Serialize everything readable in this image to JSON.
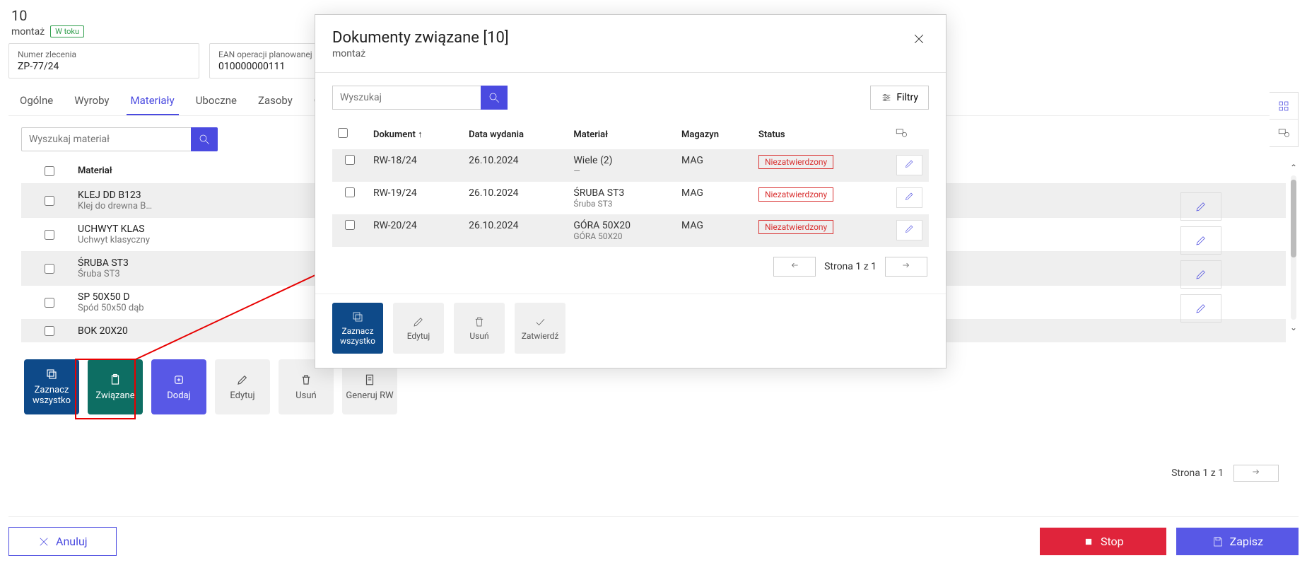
{
  "header": {
    "number": "10",
    "name": "montaż",
    "status": "W toku"
  },
  "info": {
    "order_no_label": "Numer zlecenia",
    "order_no": "ZP-77/24",
    "ean_label": "EAN operacji planowanej",
    "ean": "010000000111"
  },
  "tabs": [
    "Ogólne",
    "Wyroby",
    "Materiały",
    "Uboczne",
    "Zasoby",
    "Op"
  ],
  "active_tab_index": 2,
  "material_search_placeholder": "Wyszukaj materiał",
  "material_header": "Materiał",
  "materials": [
    {
      "code": "KLEJ DD B123",
      "desc": "Klej do drewna B…"
    },
    {
      "code": "UCHWYT KLAS",
      "desc": "Uchwyt klasyczny"
    },
    {
      "code": "ŚRUBA ST3",
      "desc": "Śruba ST3"
    },
    {
      "code": "SP 50X50 D",
      "desc": "Spód 50x50 dąb"
    },
    {
      "code": "BOK 20X20",
      "desc": ""
    }
  ],
  "page_strip_text": "Strona 1 z 1",
  "bottom_actions": {
    "select_all": "Zaznacz wszystko",
    "related": "Związane",
    "add": "Dodaj",
    "edit": "Edytuj",
    "delete": "Usuń",
    "generate_rw": "Generuj RW"
  },
  "footer": {
    "cancel": "Anuluj",
    "stop": "Stop",
    "save": "Zapisz"
  },
  "modal": {
    "title": "Dokumenty związane [10]",
    "subtitle": "montaż",
    "search_placeholder": "Wyszukaj",
    "filters_label": "Filtry",
    "columns": {
      "doc": "Dokument",
      "date": "Data wydania",
      "material": "Materiał",
      "warehouse": "Magazyn",
      "status": "Status"
    },
    "rows": [
      {
        "doc": "RW-18/24",
        "date": "26.10.2024",
        "material": "Wiele (2)",
        "material_sub": "—",
        "warehouse": "MAG",
        "status": "Niezatwierdzony"
      },
      {
        "doc": "RW-19/24",
        "date": "26.10.2024",
        "material": "ŚRUBA ST3",
        "material_sub": "Śruba ST3",
        "warehouse": "MAG",
        "status": "Niezatwierdzony"
      },
      {
        "doc": "RW-20/24",
        "date": "26.10.2024",
        "material": "GÓRA 50X20",
        "material_sub": "GÓRA 50X20",
        "warehouse": "MAG",
        "status": "Niezatwierdzony"
      }
    ],
    "pager_text": "Strona 1 z 1",
    "actions": {
      "select_all": "Zaznacz wszystko",
      "edit": "Edytuj",
      "delete": "Usuń",
      "confirm": "Zatwierdź"
    }
  }
}
